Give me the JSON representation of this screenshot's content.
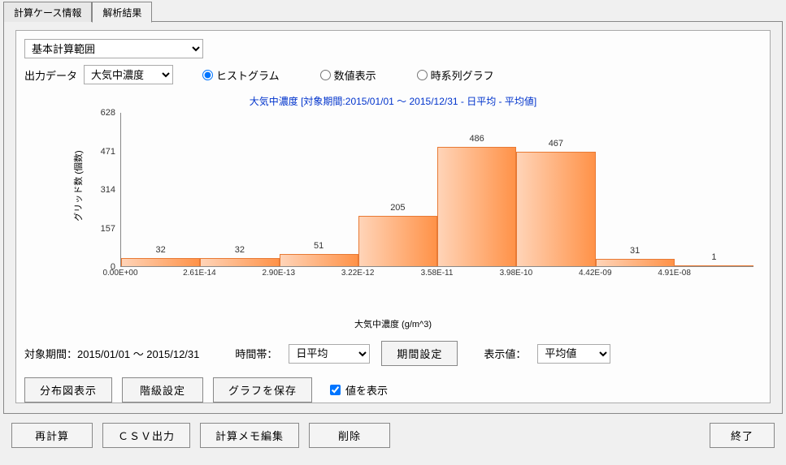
{
  "tabs": {
    "case_info": "計算ケース情報",
    "analysis": "解析結果"
  },
  "range_select": "基本計算範囲",
  "output_label": "出力データ",
  "output_select": "大気中濃度",
  "viewmode": {
    "histogram": "ヒストグラム",
    "numeric": "数値表示",
    "timeseries": "時系列グラフ"
  },
  "chart_title": "大気中濃度 [対象期間:2015/01/01 ～ 2015/12/31 - 日平均 - 平均値]",
  "ylabel": "グリッド数 (個数)",
  "xlabel": "大気中濃度 (g/m^3)",
  "chart_data": {
    "type": "bar",
    "ylabel": "グリッド数 (個数)",
    "xlabel": "大気中濃度 (g/m^3)",
    "title": "大気中濃度 [対象期間:2015/01/01 ～ 2015/12/31 - 日平均 - 平均値]",
    "ylim": [
      0,
      628
    ],
    "yticks": [
      0,
      157,
      314,
      471,
      628
    ],
    "bin_edges": [
      "0.00E+00",
      "2.61E-14",
      "2.90E-13",
      "3.22E-12",
      "3.58E-11",
      "3.98E-10",
      "4.42E-09",
      "4.91E-08"
    ],
    "values": [
      32,
      32,
      51,
      205,
      486,
      467,
      31,
      1
    ]
  },
  "period": {
    "label_prefix": "対象期間：",
    "period_text": "2015/01/01 ～ 2015/12/31",
    "timeband_label": "時間帯：",
    "timeband_value": "日平均",
    "period_set_btn": "期間設定",
    "display_label": "表示値：",
    "display_value": "平均値"
  },
  "buttons": {
    "dist_map": "分布図表示",
    "class_set": "階級設定",
    "save_graph": "グラフを保存",
    "show_values_label": "値を表示",
    "recalc": "再計算",
    "csv_export": "ＣＳＶ出力",
    "memo_edit": "計算メモ編集",
    "delete": "削除",
    "exit": "終了"
  }
}
